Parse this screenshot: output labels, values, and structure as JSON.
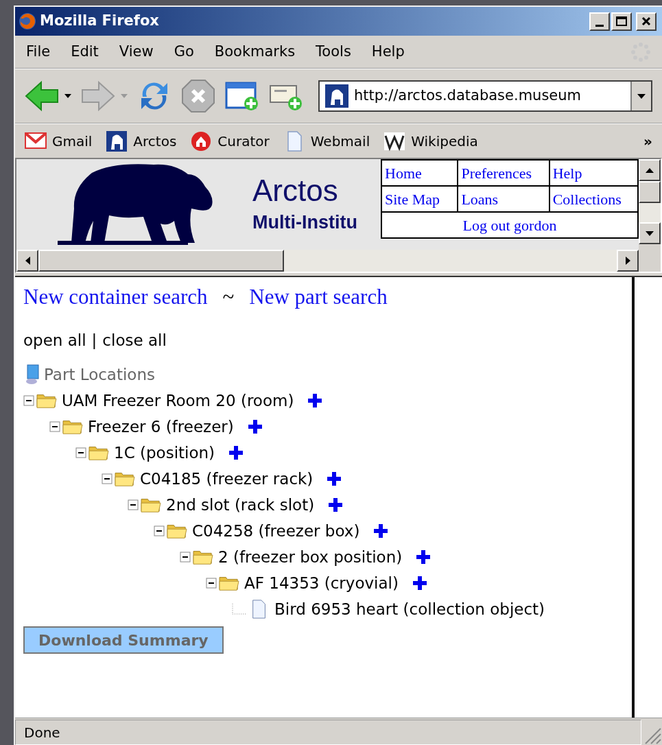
{
  "window": {
    "title": "Mozilla Firefox"
  },
  "menu": [
    "File",
    "Edit",
    "View",
    "Go",
    "Bookmarks",
    "Tools",
    "Help"
  ],
  "address": {
    "value": "http://arctos.database.museum"
  },
  "bookmarks": [
    {
      "label": "Gmail",
      "kind": "mail"
    },
    {
      "label": "Arctos",
      "kind": "bear"
    },
    {
      "label": "Curator",
      "kind": "home"
    },
    {
      "label": "Webmail",
      "kind": "page"
    },
    {
      "label": "Wikipedia",
      "kind": "wiki"
    }
  ],
  "bookmarks_more": "»",
  "header": {
    "title": "Arctos",
    "subtitle": "Multi-Institu",
    "nav": [
      [
        "Home",
        "Preferences",
        "Help"
      ],
      [
        "Site Map",
        "Loans",
        "Collections"
      ]
    ],
    "logout": "Log out gordon"
  },
  "links": [
    "New container search",
    "New part search"
  ],
  "links_separator": "~",
  "tree_controls": {
    "open": "open all",
    "separator": "|",
    "close": "close all"
  },
  "tree": {
    "label": "Part Locations",
    "children": [
      {
        "label": "UAM Freezer Room 20 (room)",
        "kind": "folder",
        "expanded": true,
        "children": [
          {
            "label": "Freezer 6 (freezer)",
            "kind": "folder",
            "expanded": true,
            "children": [
              {
                "label": "1C (position)",
                "kind": "folder",
                "expanded": true,
                "children": [
                  {
                    "label": "C04185 (freezer rack)",
                    "kind": "folder",
                    "expanded": true,
                    "children": [
                      {
                        "label": "2nd slot (rack slot)",
                        "kind": "folder",
                        "expanded": true,
                        "children": [
                          {
                            "label": "C04258 (freezer box)",
                            "kind": "folder",
                            "expanded": true,
                            "children": [
                              {
                                "label": "2 (freezer box position)",
                                "kind": "folder",
                                "expanded": true,
                                "children": [
                                  {
                                    "label": "AF 14353 (cryovial)",
                                    "kind": "folder",
                                    "expanded": true,
                                    "children": [
                                      {
                                        "label": "Bird 6953 heart (collection object)",
                                        "kind": "document"
                                      }
                                    ]
                                  }
                                ]
                              }
                            ]
                          }
                        ]
                      }
                    ]
                  }
                ]
              }
            ]
          }
        ]
      }
    ]
  },
  "download_button": "Download Summary",
  "status_bar": "Done"
}
